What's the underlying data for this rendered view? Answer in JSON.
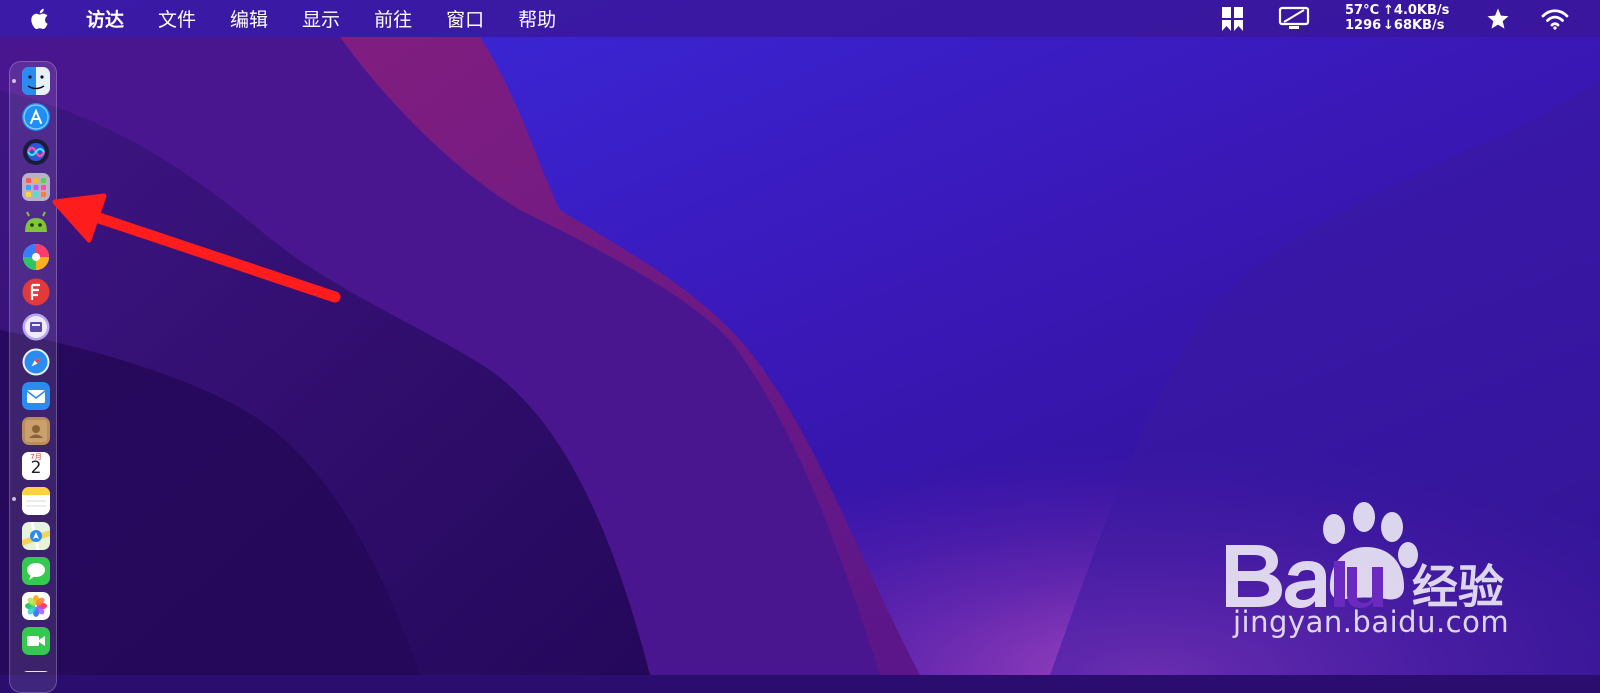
{
  "menubar": {
    "items": [
      {
        "label": "访达",
        "bold": true
      },
      {
        "label": "文件"
      },
      {
        "label": "编辑"
      },
      {
        "label": "显示"
      },
      {
        "label": "前往"
      },
      {
        "label": "窗口"
      },
      {
        "label": "帮助"
      }
    ],
    "status": {
      "temp": "57°C",
      "fan": "1296",
      "upload": "↑4.0KB/s",
      "download": "↓68KB/s",
      "icons": [
        "layout-icon",
        "display-icon",
        "star-icon",
        "wifi-icon"
      ]
    }
  },
  "dock": {
    "items": [
      {
        "name": "finder-icon",
        "running": true
      },
      {
        "name": "app-store-icon",
        "running": false
      },
      {
        "name": "siri-icon",
        "running": false
      },
      {
        "name": "launchpad-icon",
        "running": false
      },
      {
        "name": "android-icon",
        "running": false
      },
      {
        "name": "pinwheel-icon",
        "running": false
      },
      {
        "name": "red-app-icon",
        "running": false
      },
      {
        "name": "purple-app-icon",
        "running": false
      },
      {
        "name": "safari-icon",
        "running": false
      },
      {
        "name": "mail-icon",
        "running": false
      },
      {
        "name": "contacts-icon",
        "running": false
      },
      {
        "name": "calendar-icon",
        "running": false,
        "month": "7月",
        "day": "2"
      },
      {
        "name": "notes-icon",
        "running": true
      },
      {
        "name": "maps-icon",
        "running": false
      },
      {
        "name": "messages-icon",
        "running": false
      },
      {
        "name": "photos-icon",
        "running": false
      },
      {
        "name": "facetime-icon",
        "running": false
      }
    ]
  },
  "watermark": {
    "logo": "Baidu经验",
    "url": "jingyan.baidu.com"
  },
  "colors": {
    "menubar": "#3a1696",
    "arrow": "#ff1c1c",
    "wallpaper_dark": "#2a0d6e",
    "wallpaper_blue": "#3a1fd0",
    "wallpaper_magenta": "#7a1c7a"
  }
}
